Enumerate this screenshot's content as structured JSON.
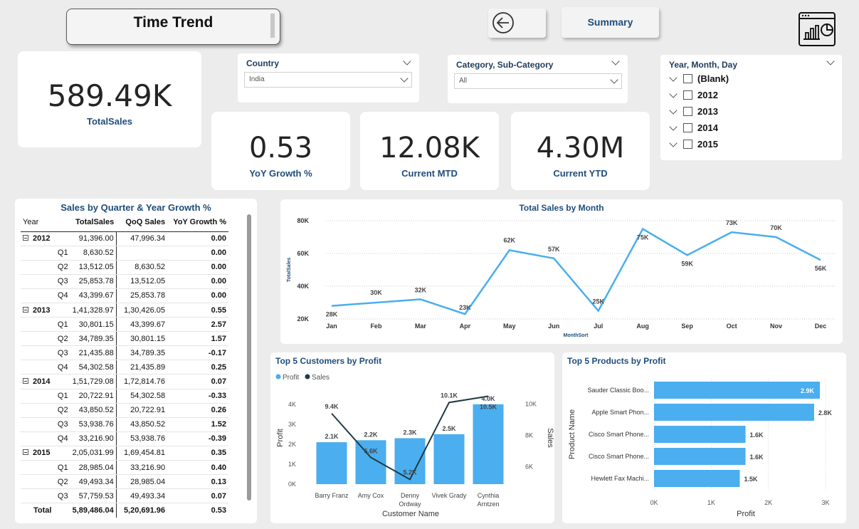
{
  "header": {
    "title": "Time Trend",
    "summary_label": "Summary",
    "back_icon": "arrow-left-circle-icon",
    "report_icon": "report-chart-icon"
  },
  "kpis": {
    "total_sales": {
      "value": "589.49K",
      "label": "TotalSales"
    },
    "yoy_growth": {
      "value": "0.53",
      "label": "YoY Growth %"
    },
    "current_mtd": {
      "value": "12.08K",
      "label": "Current MTD"
    },
    "current_ytd": {
      "value": "4.30M",
      "label": "Current YTD"
    }
  },
  "slicers": {
    "country": {
      "title": "Country",
      "value": "India"
    },
    "category": {
      "title": "Category, Sub-Category",
      "value": "All"
    },
    "date": {
      "title": "Year, Month, Day",
      "items": [
        "(Blank)",
        "2012",
        "2013",
        "2014",
        "2015"
      ]
    }
  },
  "matrix": {
    "title": "Sales by Quarter & Year Growth %",
    "columns": [
      "Year",
      "TotalSales",
      "QoQ Sales",
      "YoY Growth %"
    ],
    "rows": [
      {
        "type": "year",
        "label": "2012",
        "total": "91,396.00",
        "qoq": "47,996.34",
        "yoy": "0.00"
      },
      {
        "type": "q",
        "label": "Q1",
        "total": "8,630.52",
        "qoq": "",
        "yoy": "0.00"
      },
      {
        "type": "q",
        "label": "Q2",
        "total": "13,512.05",
        "qoq": "8,630.52",
        "yoy": "0.00"
      },
      {
        "type": "q",
        "label": "Q3",
        "total": "25,853.78",
        "qoq": "13,512.05",
        "yoy": "0.00"
      },
      {
        "type": "q",
        "label": "Q4",
        "total": "43,399.67",
        "qoq": "25,853.78",
        "yoy": "0.00"
      },
      {
        "type": "year",
        "label": "2013",
        "total": "1,41,328.97",
        "qoq": "1,30,426.05",
        "yoy": "0.55"
      },
      {
        "type": "q",
        "label": "Q1",
        "total": "30,801.15",
        "qoq": "43,399.67",
        "yoy": "2.57"
      },
      {
        "type": "q",
        "label": "Q2",
        "total": "34,789.35",
        "qoq": "30,801.15",
        "yoy": "1.57"
      },
      {
        "type": "q",
        "label": "Q3",
        "total": "21,435.88",
        "qoq": "34,789.35",
        "yoy": "-0.17"
      },
      {
        "type": "q",
        "label": "Q4",
        "total": "54,302.58",
        "qoq": "21,435.89",
        "yoy": "0.25"
      },
      {
        "type": "year",
        "label": "2014",
        "total": "1,51,729.08",
        "qoq": "1,72,814.76",
        "yoy": "0.07"
      },
      {
        "type": "q",
        "label": "Q1",
        "total": "20,722.91",
        "qoq": "54,302.58",
        "yoy": "-0.33"
      },
      {
        "type": "q",
        "label": "Q2",
        "total": "43,850.52",
        "qoq": "20,722.91",
        "yoy": "0.26"
      },
      {
        "type": "q",
        "label": "Q3",
        "total": "53,938.76",
        "qoq": "43,850.52",
        "yoy": "1.52"
      },
      {
        "type": "q",
        "label": "Q4",
        "total": "33,216.90",
        "qoq": "53,938.76",
        "yoy": "-0.39"
      },
      {
        "type": "year",
        "label": "2015",
        "total": "2,05,031.99",
        "qoq": "1,69,454.81",
        "yoy": "0.35"
      },
      {
        "type": "q",
        "label": "Q1",
        "total": "28,985.04",
        "qoq": "33,216.90",
        "yoy": "0.40"
      },
      {
        "type": "q",
        "label": "Q2",
        "total": "49,493.34",
        "qoq": "28,985.04",
        "yoy": "0.13"
      },
      {
        "type": "q",
        "label": "Q3",
        "total": "57,759.53",
        "qoq": "49,493.34",
        "yoy": "0.07"
      }
    ],
    "total": {
      "label": "Total",
      "total": "5,89,486.04",
      "qoq": "5,20,691.96",
      "yoy": "0.53"
    }
  },
  "chart_data": [
    {
      "type": "line",
      "title": "Total Sales by Month",
      "xlabel": "MonthSort",
      "ylabel": "TotalSales",
      "categories": [
        "Jan",
        "Feb",
        "Mar",
        "Apr",
        "May",
        "Jun",
        "Jul",
        "Aug",
        "Sep",
        "Oct",
        "Nov",
        "Dec"
      ],
      "values": [
        28,
        30,
        32,
        23,
        62,
        57,
        25,
        75,
        59,
        73,
        70,
        56
      ],
      "data_labels": [
        "28K",
        "30K",
        "32K",
        "23K",
        "62K",
        "57K",
        "25K",
        "75K",
        "59K",
        "73K",
        "70K",
        "56K"
      ],
      "ylim": [
        20,
        80
      ],
      "yticks": [
        "20K",
        "40K",
        "60K",
        "80K"
      ],
      "ytick_values": [
        20,
        40,
        60,
        80
      ],
      "color": "#4aaeef"
    },
    {
      "type": "bar",
      "title": "Top 5 Customers by Profit",
      "xlabel": "Customer Name",
      "ylabel": "Profit",
      "y2label": "Sales",
      "categories": [
        "Barry Franz",
        "Amy Cox",
        "Denny Ordway",
        "Vivek Grady",
        "Cynthia Arntzen"
      ],
      "series": [
        {
          "name": "Profit",
          "values": [
            2.1,
            2.2,
            2.3,
            2.5,
            4.0
          ],
          "labels": [
            "2.1K",
            "2.2K",
            "2.3K",
            "2.5K",
            "4.0K"
          ],
          "color": "#4aaeef"
        },
        {
          "name": "Sales",
          "values": [
            9.4,
            6.6,
            5.2,
            10.1,
            10.5
          ],
          "labels": [
            "9.4K",
            "6.6K",
            "5.2K",
            "10.1K",
            "10.5K"
          ],
          "color": "#1f3b44"
        }
      ],
      "ylim": [
        0,
        4.6
      ],
      "y2lim": [
        4.9,
        10.75
      ],
      "yticks": [
        "0K",
        "1K",
        "2K",
        "3K",
        "4K"
      ],
      "ytick_values": [
        0,
        1,
        2,
        3,
        4
      ],
      "y2ticks": [
        "6K",
        "8K",
        "10K"
      ],
      "y2tick_values": [
        6,
        8,
        10
      ]
    },
    {
      "type": "bar",
      "orientation": "horizontal",
      "title": "Top 5 Products by Profit",
      "xlabel": "Profit",
      "ylabel": "Product Name",
      "categories": [
        "Sauder Classic Boo...",
        "Apple Smart Phon...",
        "Cisco Smart Phone...",
        "Cisco Smart Phone...",
        "Hewlett Fax Machi..."
      ],
      "values": [
        2.9,
        2.8,
        1.6,
        1.6,
        1.5
      ],
      "data_labels": [
        "2.9K",
        "2.8K",
        "1.6K",
        "1.6K",
        "1.5K"
      ],
      "xlim": [
        0,
        3
      ],
      "xticks": [
        "0K",
        "1K",
        "2K",
        "3K"
      ],
      "xtick_values": [
        0,
        1,
        2,
        3
      ],
      "color": "#4aaeef"
    }
  ]
}
